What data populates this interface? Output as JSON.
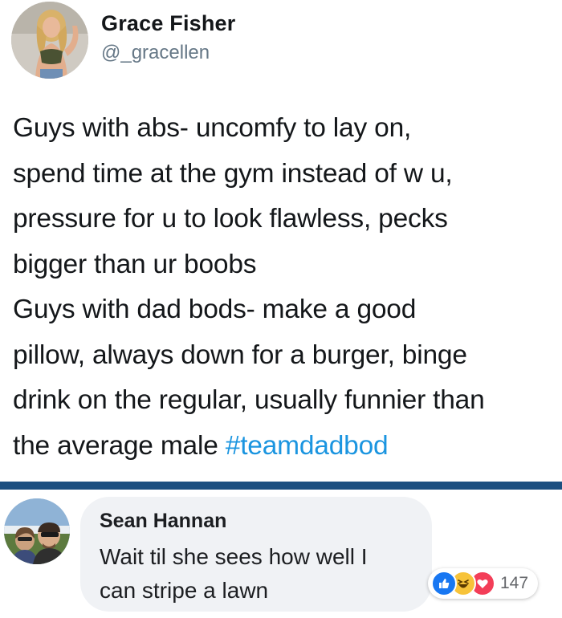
{
  "tweet": {
    "author_name": "Grace Fisher",
    "author_handle": "@_gracellen",
    "body_lines": [
      "Guys with abs- uncomfy to lay on,",
      "spend time at the gym instead of w u,",
      "pressure for u to look flawless, pecks",
      "bigger than ur boobs",
      "Guys with dad bods- make a good",
      "pillow, always down for a burger, binge",
      "drink on the regular, usually funnier than"
    ],
    "last_line_text": "the average male ",
    "hashtag": "#teamdadbod"
  },
  "comment": {
    "author_name": "Sean Hannan",
    "text_lines": [
      "Wait til she sees how well I",
      "can stripe a lawn"
    ],
    "reaction_count": "147",
    "reaction_icons": [
      "like-icon",
      "haha-icon",
      "love-icon"
    ]
  },
  "colors": {
    "divider": "#1c4f80",
    "hashtag": "#1b95e0",
    "handle": "#657786",
    "comment_bubble": "#f0f2f5",
    "like": "#1877f2",
    "haha": "#f7c33a",
    "love": "#f33e58"
  }
}
